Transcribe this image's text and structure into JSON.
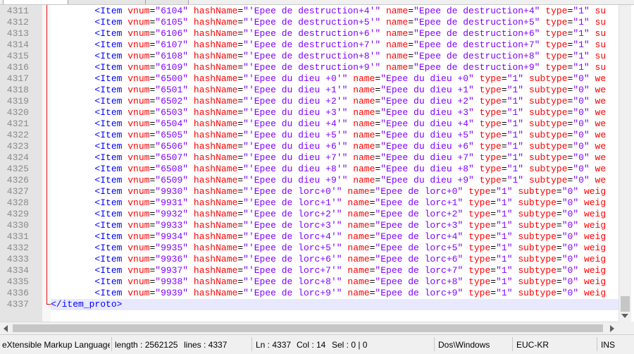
{
  "editor": {
    "current_line": 4337,
    "closing_tag": "</item_proto>",
    "rows": [
      {
        "num": "4311",
        "vnum": "6104",
        "hash": "'Epee de destruction+4'",
        "name": "Epee de destruction+4",
        "type": "1",
        "tail_attr": "su",
        "tail_val": ""
      },
      {
        "num": "4312",
        "vnum": "6105",
        "hash": "'Epee de destruction+5'",
        "name": "Epee de destruction+5",
        "type": "1",
        "tail_attr": "su",
        "tail_val": ""
      },
      {
        "num": "4313",
        "vnum": "6106",
        "hash": "'Epee de destruction+6'",
        "name": "Epee de destruction+6",
        "type": "1",
        "tail_attr": "su",
        "tail_val": ""
      },
      {
        "num": "4314",
        "vnum": "6107",
        "hash": "'Epee de destruction+7'",
        "name": "Epee de destruction+7",
        "type": "1",
        "tail_attr": "su",
        "tail_val": ""
      },
      {
        "num": "4315",
        "vnum": "6108",
        "hash": "'Epee de destruction+8'",
        "name": "Epee de destruction+8",
        "type": "1",
        "tail_attr": "su",
        "tail_val": ""
      },
      {
        "num": "4316",
        "vnum": "6109",
        "hash": "'Epee de destruction+9'",
        "name": "Epee de destruction+9",
        "type": "1",
        "tail_attr": "su",
        "tail_val": ""
      },
      {
        "num": "4317",
        "vnum": "6500",
        "hash": "'Epee du dieu +0'",
        "name": "Epee du dieu +0",
        "type": "1",
        "tail_attr": "subtype",
        "tail_val": "0",
        "end": "we"
      },
      {
        "num": "4318",
        "vnum": "6501",
        "hash": "'Epee du dieu +1'",
        "name": "Epee du dieu +1",
        "type": "1",
        "tail_attr": "subtype",
        "tail_val": "0",
        "end": "we"
      },
      {
        "num": "4319",
        "vnum": "6502",
        "hash": "'Epee du dieu +2'",
        "name": "Epee du dieu +2",
        "type": "1",
        "tail_attr": "subtype",
        "tail_val": "0",
        "end": "we"
      },
      {
        "num": "4320",
        "vnum": "6503",
        "hash": "'Epee du dieu +3'",
        "name": "Epee du dieu +3",
        "type": "1",
        "tail_attr": "subtype",
        "tail_val": "0",
        "end": "we"
      },
      {
        "num": "4321",
        "vnum": "6504",
        "hash": "'Epee du dieu +4'",
        "name": "Epee du dieu +4",
        "type": "1",
        "tail_attr": "subtype",
        "tail_val": "0",
        "end": "we"
      },
      {
        "num": "4322",
        "vnum": "6505",
        "hash": "'Epee du dieu +5'",
        "name": "Epee du dieu +5",
        "type": "1",
        "tail_attr": "subtype",
        "tail_val": "0",
        "end": "we"
      },
      {
        "num": "4323",
        "vnum": "6506",
        "hash": "'Epee du dieu +6'",
        "name": "Epee du dieu +6",
        "type": "1",
        "tail_attr": "subtype",
        "tail_val": "0",
        "end": "we"
      },
      {
        "num": "4324",
        "vnum": "6507",
        "hash": "'Epee du dieu +7'",
        "name": "Epee du dieu +7",
        "type": "1",
        "tail_attr": "subtype",
        "tail_val": "0",
        "end": "we"
      },
      {
        "num": "4325",
        "vnum": "6508",
        "hash": "'Epee du dieu +8'",
        "name": "Epee du dieu +8",
        "type": "1",
        "tail_attr": "subtype",
        "tail_val": "0",
        "end": "we"
      },
      {
        "num": "4326",
        "vnum": "6509",
        "hash": "'Epee du dieu +9'",
        "name": "Epee du dieu +9",
        "type": "1",
        "tail_attr": "subtype",
        "tail_val": "0",
        "end": "we"
      },
      {
        "num": "4327",
        "vnum": "9930",
        "hash": "'Epee de lorc+0'",
        "name": "Epee de lorc+0",
        "type": "1",
        "tail_attr": "subtype",
        "tail_val": "0",
        "end": "weig"
      },
      {
        "num": "4328",
        "vnum": "9931",
        "hash": "'Epee de lorc+1'",
        "name": "Epee de lorc+1",
        "type": "1",
        "tail_attr": "subtype",
        "tail_val": "0",
        "end": "weig"
      },
      {
        "num": "4329",
        "vnum": "9932",
        "hash": "'Epee de lorc+2'",
        "name": "Epee de lorc+2",
        "type": "1",
        "tail_attr": "subtype",
        "tail_val": "0",
        "end": "weig"
      },
      {
        "num": "4330",
        "vnum": "9933",
        "hash": "'Epee de lorc+3'",
        "name": "Epee de lorc+3",
        "type": "1",
        "tail_attr": "subtype",
        "tail_val": "0",
        "end": "weig"
      },
      {
        "num": "4331",
        "vnum": "9934",
        "hash": "'Epee de lorc+4'",
        "name": "Epee de lorc+4",
        "type": "1",
        "tail_attr": "subtype",
        "tail_val": "0",
        "end": "weig"
      },
      {
        "num": "4332",
        "vnum": "9935",
        "hash": "'Epee de lorc+5'",
        "name": "Epee de lorc+5",
        "type": "1",
        "tail_attr": "subtype",
        "tail_val": "0",
        "end": "weig"
      },
      {
        "num": "4333",
        "vnum": "9936",
        "hash": "'Epee de lorc+6'",
        "name": "Epee de lorc+6",
        "type": "1",
        "tail_attr": "subtype",
        "tail_val": "0",
        "end": "weig"
      },
      {
        "num": "4334",
        "vnum": "9937",
        "hash": "'Epee de lorc+7'",
        "name": "Epee de lorc+7",
        "type": "1",
        "tail_attr": "subtype",
        "tail_val": "0",
        "end": "weig"
      },
      {
        "num": "4335",
        "vnum": "9938",
        "hash": "'Epee de lorc+8'",
        "name": "Epee de lorc+8",
        "type": "1",
        "tail_attr": "subtype",
        "tail_val": "0",
        "end": "weig"
      },
      {
        "num": "4336",
        "vnum": "9939",
        "hash": "'Epee de lorc+9'",
        "name": "Epee de lorc+9",
        "type": "1",
        "tail_attr": "subtype",
        "tail_val": "0",
        "end": "weig"
      },
      {
        "num": "4337",
        "closing": true
      }
    ]
  },
  "statusbar": {
    "language": "eXtensible Markup Language fi",
    "length": "length : 2562125",
    "lines": "lines : 4337",
    "ln": "Ln : 4337",
    "col": "Col : 14",
    "sel": "Sel : 0 | 0",
    "eol": "Dos\\Windows",
    "encoding": "EUC-KR",
    "mode": "INS"
  },
  "colors": {
    "tag": "#0000ff",
    "attribute": "#ff0000",
    "value": "#8000ff",
    "current_line_bg": "#e8e8ff",
    "fold_marker": "#e81010"
  }
}
